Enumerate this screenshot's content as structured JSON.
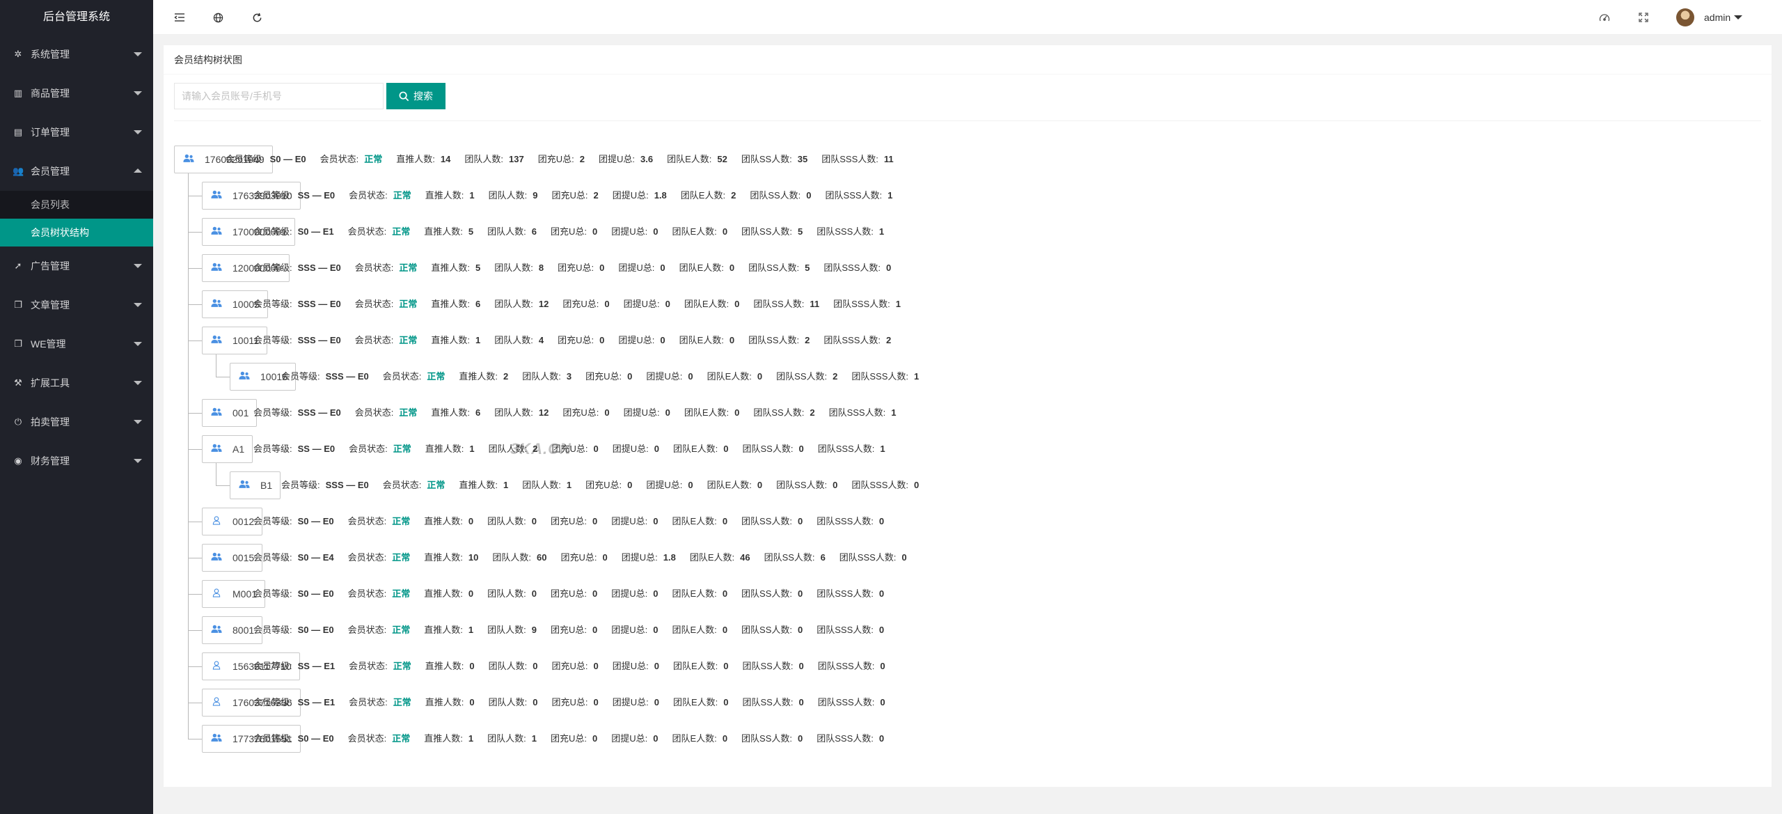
{
  "app_title": "后台管理系统",
  "sidebar": {
    "items": [
      {
        "label": "系统管理",
        "icon": "gear-icon"
      },
      {
        "label": "商品管理",
        "icon": "bar-chart-icon"
      },
      {
        "label": "订单管理",
        "icon": "list-icon"
      },
      {
        "label": "会员管理",
        "icon": "users-icon",
        "open": true,
        "children": [
          {
            "label": "会员列表",
            "active": false
          },
          {
            "label": "会员树状结构",
            "active": true
          }
        ]
      },
      {
        "label": "广告管理",
        "icon": "rocket-icon"
      },
      {
        "label": "文章管理",
        "icon": "copy-icon"
      },
      {
        "label": "WE管理",
        "icon": "copy-icon"
      },
      {
        "label": "扩展工具",
        "icon": "wrench-icon"
      },
      {
        "label": "拍卖管理",
        "icon": "power-icon"
      },
      {
        "label": "财务管理",
        "icon": "circle-dot-icon"
      }
    ]
  },
  "header": {
    "user_name": "admin",
    "left_icons": [
      "menu-fold-icon",
      "globe-icon",
      "refresh-icon"
    ],
    "right_icons": [
      "theme-icon",
      "fullscreen-icon"
    ]
  },
  "main": {
    "title": "会员结构树状图",
    "search": {
      "placeholder": "请输入会员账号/手机号",
      "button_label": "搜索"
    },
    "labels": {
      "level": "会员等级:",
      "status": "会员状态:",
      "direct": "直推人数:",
      "team": "团队人数:",
      "charge": "团充U总:",
      "withdraw": "团提U总:",
      "team_e": "团队E人数:",
      "team_ss": "团队SS人数:",
      "team_sss": "团队SSS人数:"
    },
    "nodes": [
      {
        "account": "17600291049",
        "depth": 0,
        "has_team": true,
        "level": "S0 — E0",
        "status": "正常",
        "direct": "14",
        "team": "137",
        "charge": "2",
        "withdraw": "3.6",
        "team_e": "52",
        "team_ss": "35",
        "team_sss": "11"
      },
      {
        "account": "17633903010",
        "depth": 1,
        "has_team": true,
        "level": "SS — E0",
        "status": "正常",
        "direct": "1",
        "team": "9",
        "charge": "2",
        "withdraw": "1.8",
        "team_e": "2",
        "team_ss": "0",
        "team_sss": "1"
      },
      {
        "account": "1700000001",
        "depth": 1,
        "has_team": true,
        "level": "S0 — E1",
        "status": "正常",
        "direct": "5",
        "team": "6",
        "charge": "0",
        "withdraw": "0",
        "team_e": "0",
        "team_ss": "5",
        "team_sss": "1"
      },
      {
        "account": "120000000",
        "depth": 1,
        "has_team": true,
        "level": "SSS — E0",
        "status": "正常",
        "direct": "5",
        "team": "8",
        "charge": "0",
        "withdraw": "0",
        "team_e": "0",
        "team_ss": "5",
        "team_sss": "0"
      },
      {
        "account": "10005",
        "depth": 1,
        "has_team": true,
        "level": "SSS — E0",
        "status": "正常",
        "direct": "6",
        "team": "12",
        "charge": "0",
        "withdraw": "0",
        "team_e": "0",
        "team_ss": "11",
        "team_sss": "1"
      },
      {
        "account": "10011",
        "depth": 1,
        "has_team": true,
        "level": "SSS — E0",
        "status": "正常",
        "direct": "1",
        "team": "4",
        "charge": "0",
        "withdraw": "0",
        "team_e": "0",
        "team_ss": "2",
        "team_sss": "2"
      },
      {
        "account": "10016",
        "depth": 2,
        "has_team": true,
        "level": "SSS — E0",
        "status": "正常",
        "direct": "2",
        "team": "3",
        "charge": "0",
        "withdraw": "0",
        "team_e": "0",
        "team_ss": "2",
        "team_sss": "1"
      },
      {
        "account": "001",
        "depth": 1,
        "has_team": true,
        "level": "SSS — E0",
        "status": "正常",
        "direct": "6",
        "team": "12",
        "charge": "0",
        "withdraw": "0",
        "team_e": "0",
        "team_ss": "2",
        "team_sss": "1"
      },
      {
        "account": "A1",
        "depth": 1,
        "has_team": true,
        "level": "SS — E0",
        "status": "正常",
        "direct": "1",
        "team": "2",
        "charge": "0",
        "withdraw": "0",
        "team_e": "0",
        "team_ss": "0",
        "team_sss": "1"
      },
      {
        "account": "B1",
        "depth": 2,
        "has_team": true,
        "level": "SSS — E0",
        "status": "正常",
        "direct": "1",
        "team": "1",
        "charge": "0",
        "withdraw": "0",
        "team_e": "0",
        "team_ss": "0",
        "team_sss": "0"
      },
      {
        "account": "0012",
        "depth": 1,
        "has_team": false,
        "level": "S0 — E0",
        "status": "正常",
        "direct": "0",
        "team": "0",
        "charge": "0",
        "withdraw": "0",
        "team_e": "0",
        "team_ss": "0",
        "team_sss": "0"
      },
      {
        "account": "0015",
        "depth": 1,
        "has_team": true,
        "level": "S0 — E4",
        "status": "正常",
        "direct": "10",
        "team": "60",
        "charge": "0",
        "withdraw": "1.8",
        "team_e": "46",
        "team_ss": "6",
        "team_sss": "0"
      },
      {
        "account": "M001",
        "depth": 1,
        "has_team": false,
        "level": "S0 — E0",
        "status": "正常",
        "direct": "0",
        "team": "0",
        "charge": "0",
        "withdraw": "0",
        "team_e": "0",
        "team_ss": "0",
        "team_sss": "0"
      },
      {
        "account": "8001",
        "depth": 1,
        "has_team": true,
        "level": "S0 — E0",
        "status": "正常",
        "direct": "1",
        "team": "9",
        "charge": "0",
        "withdraw": "0",
        "team_e": "0",
        "team_ss": "0",
        "team_sss": "0"
      },
      {
        "account": "15638117710",
        "depth": 1,
        "has_team": false,
        "level": "SS — E1",
        "status": "正常",
        "direct": "0",
        "team": "0",
        "charge": "0",
        "withdraw": "0",
        "team_e": "0",
        "team_ss": "0",
        "team_sss": "0"
      },
      {
        "account": "17603716336",
        "depth": 1,
        "has_team": false,
        "level": "SS — E1",
        "status": "正常",
        "direct": "0",
        "team": "0",
        "charge": "0",
        "withdraw": "0",
        "team_e": "0",
        "team_ss": "0",
        "team_sss": "0"
      },
      {
        "account": "17737601551",
        "depth": 1,
        "has_team": true,
        "level": "S0 — E0",
        "status": "正常",
        "direct": "1",
        "team": "1",
        "charge": "0",
        "withdraw": "0",
        "team_e": "0",
        "team_ss": "0",
        "team_sss": "0"
      }
    ],
    "watermark": "3KA.CN"
  },
  "colors": {
    "accent": "#009688",
    "sidebar_bg": "#20222a",
    "status_ok": "#009688",
    "team_icon": "#4a90e2"
  }
}
